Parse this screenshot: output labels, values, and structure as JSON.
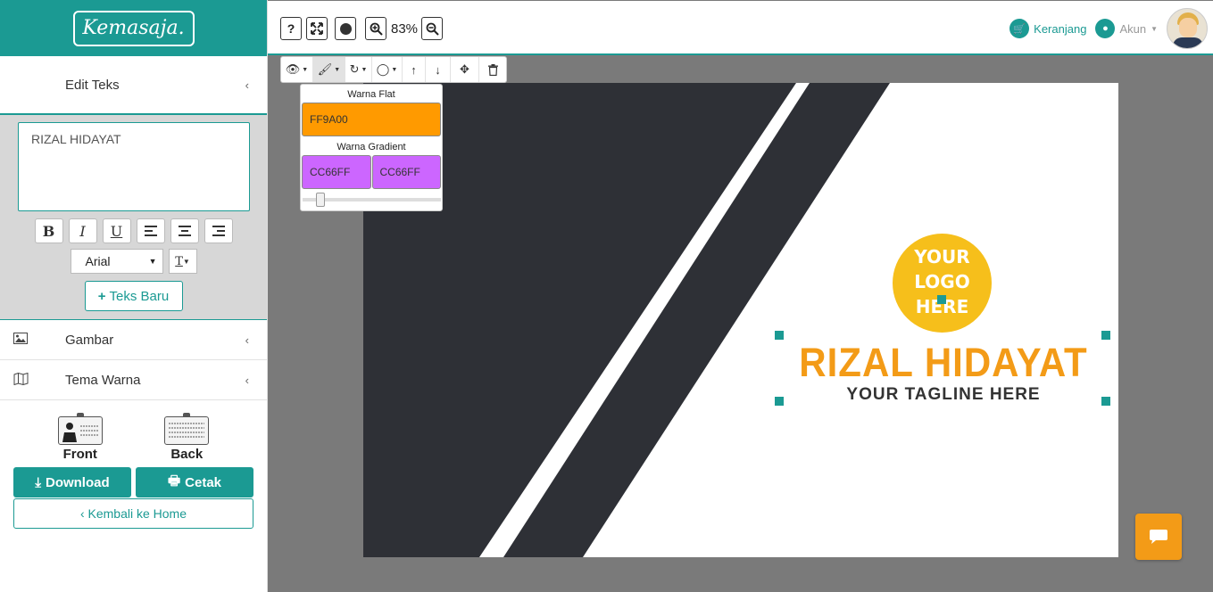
{
  "brand": {
    "logo_text": "Kemasaja."
  },
  "sidebar": {
    "edit_text": {
      "title": "Edit Teks",
      "chevron": "‹"
    },
    "textarea_value": "RIZAL HIDAYAT",
    "format_buttons": {
      "bold": "B",
      "italic": "I",
      "underline": "U"
    },
    "font": {
      "selected": "Arial",
      "text_tool": "T"
    },
    "new_text_button": "Teks Baru",
    "items": [
      {
        "label": "Gambar",
        "icon": "image-icon"
      },
      {
        "label": "Tema Warna",
        "icon": "map-icon"
      }
    ],
    "cards": {
      "front": "Front",
      "back": "Back"
    },
    "download_button": "Download",
    "print_button": "Cetak",
    "home_button": "‹ Kembali ke Home"
  },
  "topbar": {
    "help": "?",
    "zoom": "83%",
    "cart": "Keranjang",
    "account": "Akun"
  },
  "color_popup": {
    "flat_title": "Warna Flat",
    "flat_value": "FF9A00",
    "gradient_title": "Warna Gradient",
    "gradient_start": "CC66FF",
    "gradient_end": "CC66FF"
  },
  "canvas": {
    "logo_lines": [
      "YOUR",
      "LOGO",
      "HERE"
    ],
    "name": "RIZAL HIDAYAT",
    "tagline": "YOUR TAGLINE HERE"
  },
  "colors": {
    "teal": "#1b9a93",
    "orange": "#f39b17",
    "flat_swatch": "#FF9A00",
    "gradient_swatch": "#CC66FF",
    "dark_stripe": "#2e3036",
    "logo_yellow": "#f6bf1b"
  }
}
